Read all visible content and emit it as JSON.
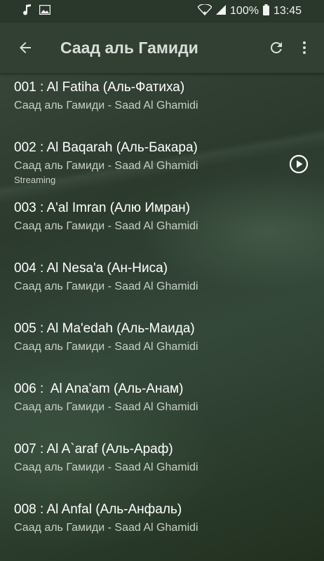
{
  "status": {
    "battery": "100%",
    "time": "13:45"
  },
  "header": {
    "title": "Саад аль Гамиди"
  },
  "tracks": [
    {
      "title": "001 : Al Fatiha (Аль-Фатиха)",
      "subtitle": "Саад аль Гамиди - Saad Al Ghamidi"
    },
    {
      "title": "002 : Al Baqarah (Аль-Бакара)",
      "subtitle": "Саад аль Гамиди - Saad Al Ghamidi",
      "status": "Streaming"
    },
    {
      "title": "003 : A'al Imran (Алю Имран)",
      "subtitle": "Саад аль Гамиди - Saad Al Ghamidi"
    },
    {
      "title": "004 : Al Nesa'a (Ан-Ниса)",
      "subtitle": "Саад аль Гамиди - Saad Al Ghamidi"
    },
    {
      "title": "005 : Al Ma'edah (Аль-Маида)",
      "subtitle": "Саад аль Гамиди - Saad Al Ghamidi"
    },
    {
      "title": "006 :  Al Ana'am (Аль-Анам)",
      "subtitle": "Саад аль Гамиди - Saad Al Ghamidi"
    },
    {
      "title": "007 : Al A`araf (Аль-Араф)",
      "subtitle": "Саад аль Гамиди - Saad Al Ghamidi"
    },
    {
      "title": "008 : Al Anfal (Аль-Анфаль)",
      "subtitle": "Саад аль Гамиди - Saad Al Ghamidi"
    }
  ]
}
